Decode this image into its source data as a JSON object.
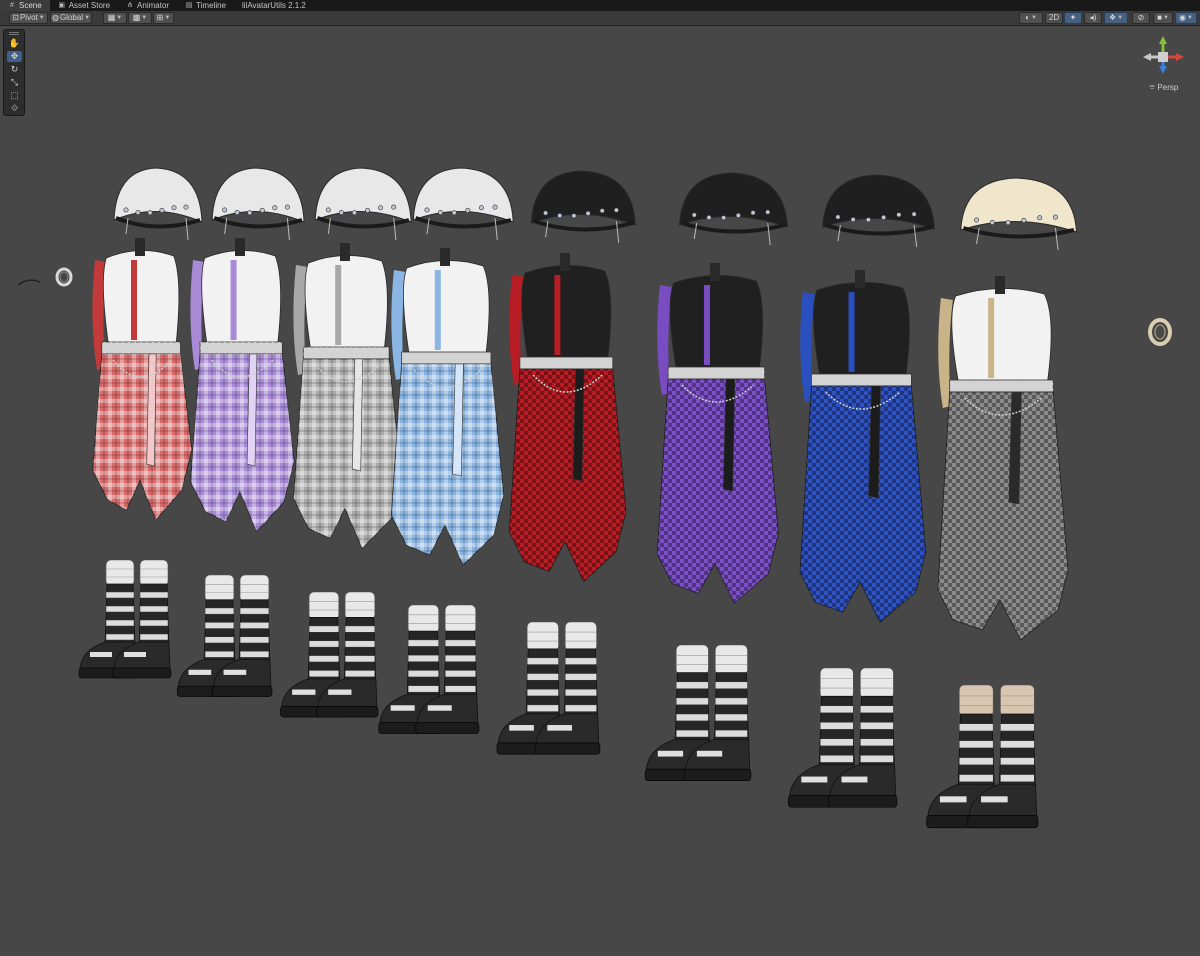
{
  "tabs": [
    {
      "label": "Scene",
      "icon": "scene-icon"
    },
    {
      "label": "Asset Store",
      "icon": "store-icon"
    },
    {
      "label": "Animator",
      "icon": "animator-icon"
    },
    {
      "label": "Timeline",
      "icon": "timeline-icon"
    },
    {
      "label": "lilAvatarUtils 2.1.2",
      "icon": ""
    }
  ],
  "toolbar": {
    "pivot_label": "Pivot",
    "global_label": "Global",
    "mode_2d_label": "2D"
  },
  "gizmo": {
    "projection_label": "Persp",
    "colors": {
      "x": "#d9453a",
      "y": "#86c13a",
      "z": "#3a7fd9",
      "neutral": "#c8c8c8"
    }
  },
  "scene": {
    "background": "#474747",
    "outfit_sets": [
      {
        "top": "#f2f2f2",
        "accent": "#c23a3a",
        "skirt": "#d86a6a",
        "skirt_alt": "#f3c8c8",
        "hat": "#e8e8e8",
        "sock": "#e8e8e8"
      },
      {
        "top": "#f2f2f2",
        "accent": "#a88ad6",
        "skirt": "#a98bd8",
        "skirt_alt": "#e1d3f4",
        "hat": "#e8e8e8",
        "sock": "#e8e8e8"
      },
      {
        "top": "#f2f2f2",
        "accent": "#a8a8a8",
        "skirt": "#a9a9a9",
        "skirt_alt": "#e6e6e6",
        "hat": "#e8e8e8",
        "sock": "#e8e8e8"
      },
      {
        "top": "#f2f2f2",
        "accent": "#8bb6e3",
        "skirt": "#8ab4e2",
        "skirt_alt": "#d5e6f8",
        "hat": "#e8e8e8",
        "sock": "#e8e8e8"
      },
      {
        "top": "#202020",
        "accent": "#b81c24",
        "skirt": "#b81c24",
        "skirt_alt": "#1c1c1c",
        "hat": "#1f1f1f",
        "sock": "#e8e8e8"
      },
      {
        "top": "#202020",
        "accent": "#7a4cc2",
        "skirt": "#7c4fc9",
        "skirt_alt": "#1c1c1c",
        "hat": "#1f1f1f",
        "sock": "#e8e8e8"
      },
      {
        "top": "#202020",
        "accent": "#2a4fbf",
        "skirt": "#2e52c4",
        "skirt_alt": "#1c1c1c",
        "hat": "#1f1f1f",
        "sock": "#e8e8e8"
      },
      {
        "top": "#f2f2f2",
        "accent": "#c9b48a",
        "skirt": "#8a8a8a",
        "skirt_alt": "#2a2a2a",
        "hat": "#efe6cc",
        "sock": "#d9c6b0"
      }
    ]
  }
}
